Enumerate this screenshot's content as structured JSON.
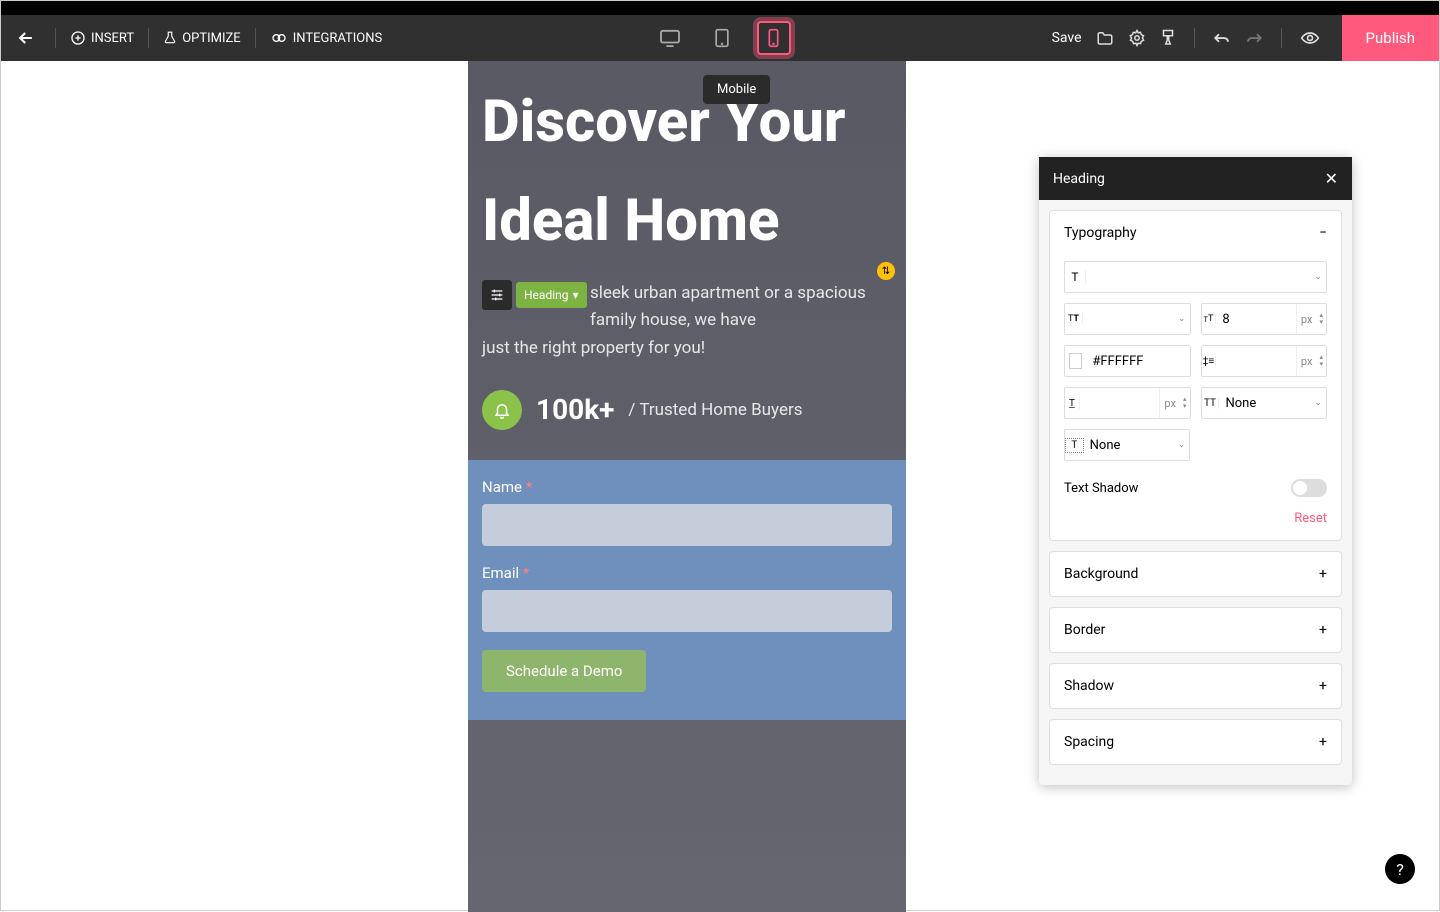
{
  "toolbar": {
    "insert": "INSERT",
    "optimize": "OPTIMIZE",
    "integrations": "INTEGRATIONS",
    "save": "Save",
    "publish": "Publish"
  },
  "tooltip": "Mobile",
  "canvas": {
    "headline": "Discover Your Ideal Home",
    "element_chip": "Heading",
    "subtext_line1": "sleek urban apartment or a spacious family house, we have",
    "subtext_line2": " just the right property for you!",
    "stat_number": "100k+",
    "stat_label": "/ Trusted Home Buyers",
    "form": {
      "name_label": "Name",
      "email_label": "Email",
      "button": "Schedule a Demo"
    }
  },
  "panel": {
    "title": "Heading",
    "sections": {
      "typography": "Typography",
      "background": "Background",
      "border": "Border",
      "shadow": "Shadow",
      "spacing": "Spacing"
    },
    "typography": {
      "font_size_value": "8",
      "font_size_unit": "px",
      "color_value": "#FFFFFF",
      "line_height_unit": "px",
      "letter_spacing_unit": "px",
      "text_transform_value": "None",
      "text_decoration_value": "None",
      "text_shadow_label": "Text Shadow",
      "reset": "Reset"
    }
  }
}
